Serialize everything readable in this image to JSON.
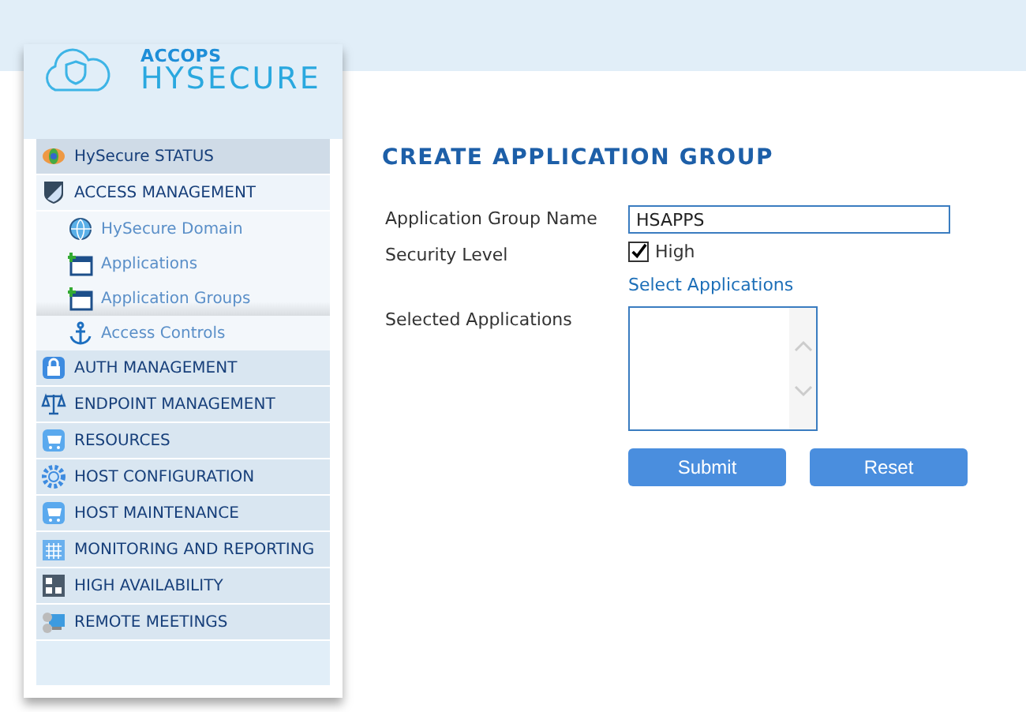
{
  "logo": {
    "brand": "ACCOPS",
    "product": "HYSECURE"
  },
  "sidebar": {
    "items": [
      {
        "label": "HySecure STATUS",
        "expanded": false
      },
      {
        "label": "ACCESS MANAGEMENT",
        "expanded": true,
        "children": [
          {
            "label": "HySecure Domain",
            "selected": false
          },
          {
            "label": "Applications",
            "selected": false
          },
          {
            "label": "Application Groups",
            "selected": true
          },
          {
            "label": "Access Controls",
            "selected": false
          }
        ]
      },
      {
        "label": "AUTH MANAGEMENT",
        "expanded": false
      },
      {
        "label": "ENDPOINT MANAGEMENT",
        "expanded": false
      },
      {
        "label": "RESOURCES",
        "expanded": false
      },
      {
        "label": "HOST CONFIGURATION",
        "expanded": false
      },
      {
        "label": "HOST MAINTENANCE",
        "expanded": false
      },
      {
        "label": "MONITORING AND REPORTING",
        "expanded": false
      },
      {
        "label": "HIGH AVAILABILITY",
        "expanded": false
      },
      {
        "label": "REMOTE MEETINGS",
        "expanded": false
      }
    ]
  },
  "form": {
    "title": "CREATE APPLICATION GROUP",
    "name_label": "Application Group Name",
    "name_value": "HSAPPS",
    "security_label": "Security Level",
    "security_option": "High",
    "security_checked": true,
    "select_link": "Select Applications",
    "selected_label": "Selected Applications",
    "buttons": [
      "Submit",
      "Reset"
    ]
  }
}
